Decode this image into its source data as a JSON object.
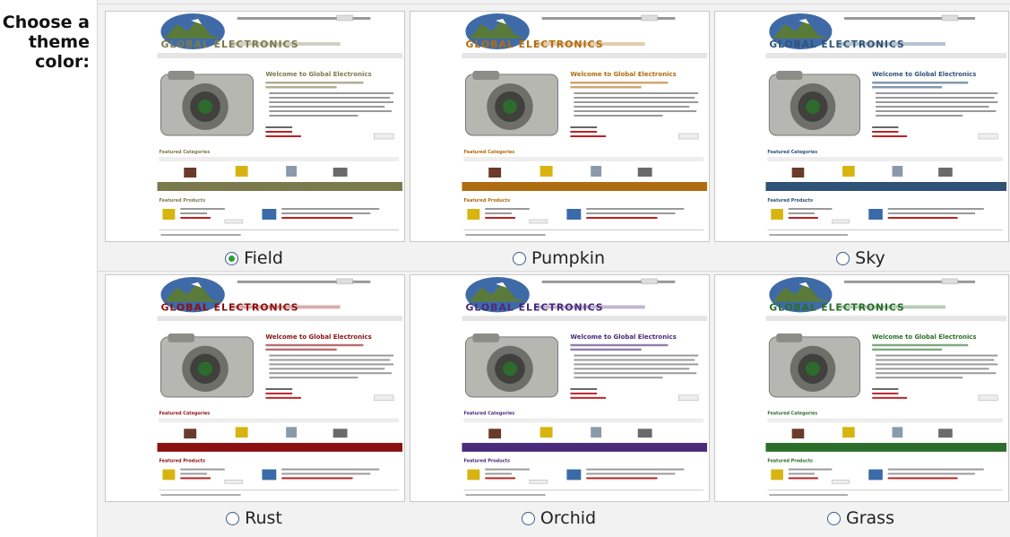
{
  "prompt_label": "Choose a theme color:",
  "themes": [
    {
      "name": "Field",
      "color": "#7b7a4e",
      "selected": true
    },
    {
      "name": "Pumpkin",
      "color": "#b06c10",
      "selected": false
    },
    {
      "name": "Sky",
      "color": "#2e5377",
      "selected": false
    },
    {
      "name": "Rust",
      "color": "#8b1111",
      "selected": false
    },
    {
      "name": "Orchid",
      "color": "#4a2a7a",
      "selected": false
    },
    {
      "name": "Grass",
      "color": "#2b6e2b",
      "selected": false
    }
  ],
  "preview": {
    "brand": "GLOBAL ELECTRONICS",
    "welcome": "Welcome to Global Electronics",
    "featured_categories": "Featured Categories",
    "featured_products": "Featured Products"
  }
}
